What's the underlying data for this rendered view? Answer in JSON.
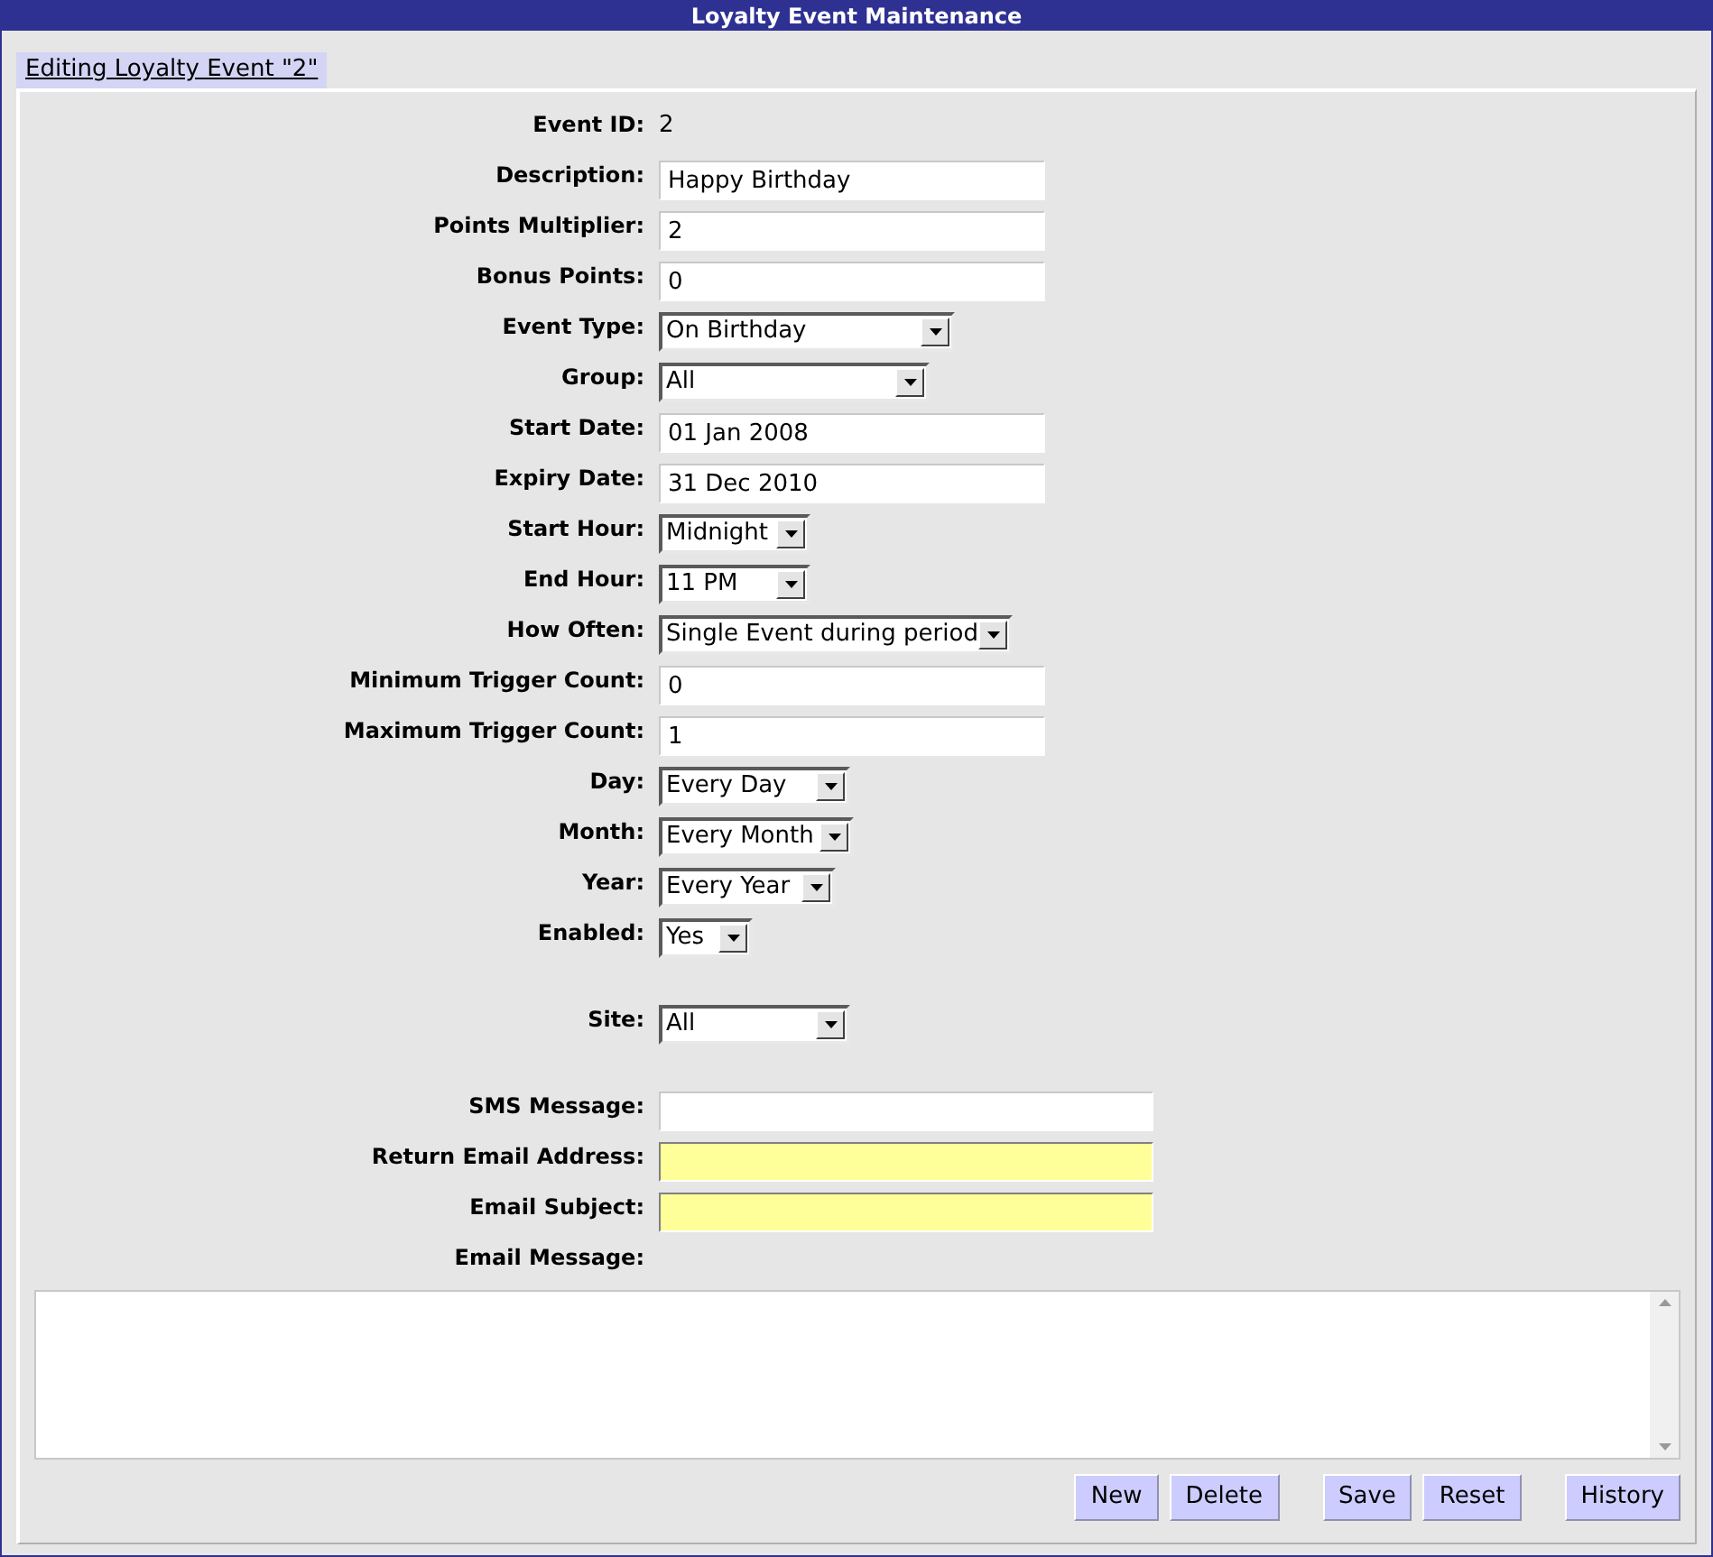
{
  "window": {
    "title": "Loyalty Event Maintenance"
  },
  "tab": {
    "label": "Editing Loyalty Event \"2\"",
    "selected": true
  },
  "sections": [
    {
      "fields": [
        {
          "label": "Event ID:",
          "kind": "static",
          "value": "2"
        },
        {
          "label": "Description:",
          "kind": "text",
          "value": "Happy Birthday",
          "highlighted": false
        },
        {
          "label": "Points Multiplier:",
          "kind": "text",
          "value": "2",
          "highlighted": false
        },
        {
          "label": "Bonus Points:",
          "kind": "text",
          "value": "0",
          "highlighted": false
        },
        {
          "label": "Event Type:",
          "kind": "select",
          "value": "On Birthday"
        },
        {
          "label": "Group:",
          "kind": "select",
          "value": "All"
        },
        {
          "label": "Start Date:",
          "kind": "text",
          "value": "01 Jan 2008",
          "highlighted": false
        },
        {
          "label": "Expiry Date:",
          "kind": "text",
          "value": "31 Dec 2010",
          "highlighted": false
        },
        {
          "label": "Start Hour:",
          "kind": "select",
          "value": "Midnight"
        },
        {
          "label": "End Hour:",
          "kind": "select",
          "value": "11 PM"
        },
        {
          "label": "How Often:",
          "kind": "select",
          "value": "Single Event during period"
        },
        {
          "label": "Minimum Trigger Count:",
          "kind": "text",
          "value": "0",
          "highlighted": false
        },
        {
          "label": "Maximum Trigger Count:",
          "kind": "text",
          "value": "1",
          "highlighted": false
        },
        {
          "label": "Day:",
          "kind": "select",
          "value": "Every Day"
        },
        {
          "label": "Month:",
          "kind": "select",
          "value": "Every Month"
        },
        {
          "label": "Year:",
          "kind": "select",
          "value": "Every Year"
        },
        {
          "label": "Enabled:",
          "kind": "select",
          "value": "Yes"
        }
      ]
    },
    {
      "fields": [
        {
          "label": "Site:",
          "kind": "select",
          "value": "All"
        }
      ]
    },
    {
      "fields": [
        {
          "label": "SMS Message:",
          "kind": "text",
          "highlighted": false
        },
        {
          "label": "Return Email Address:",
          "kind": "text",
          "highlighted": true
        },
        {
          "label": "Email Subject:",
          "kind": "text",
          "highlighted": true
        },
        {
          "label": "Email Message:",
          "kind": "static"
        }
      ]
    }
  ],
  "buttons": [
    {
      "label": "New"
    },
    {
      "label": "Delete"
    },
    {
      "label": "Save"
    },
    {
      "label": "Reset"
    },
    {
      "label": "History"
    }
  ]
}
